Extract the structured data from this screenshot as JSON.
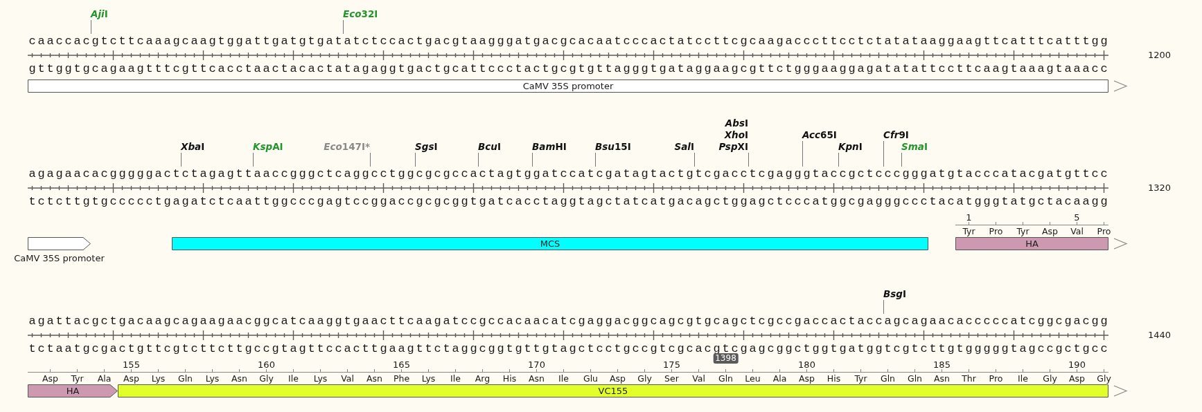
{
  "blocks": [
    {
      "top": [
        "caaccac",
        "gtcttcaaagcaagtggattgatgtgat",
        "atctccactgacgtaagggatgacgcacaatcccactatccttcgcaagacccttcctctatataaggaagttcatttcatttgg"
      ],
      "sites": [
        {
          "kind": "rightward",
          "enzymes": [
            {
              "genus": "Aji",
              "suffix": "I",
              "color": "#22962a"
            }
          ]
        },
        {
          "kind": "rightward",
          "enzymes": [
            {
              "genus": "Eco",
              "suffix": "32I",
              "color": "#22962a"
            }
          ]
        }
      ],
      "bottom": [
        "gttggtgcagaagtttcgttcacctaactacactatagaggtgactgcattccctactgcgtgttagggtgataggaagcgttctgggaaggagatatattccttcaagtaaagtaaacc"
      ],
      "features": [
        {
          "kind": "arrow",
          "name": "CaMV 35S promoter",
          "color": "#ffffff",
          "continues_right": true
        }
      ],
      "number": "1200"
    },
    {
      "top": [
        "agagaacacgggggact",
        "ctagagtt",
        "aaccgggctcagg",
        "cctgg",
        "cgcgcca",
        "ctagtg",
        "gatccat",
        "cgatagtactg",
        "tcgacc",
        "tcgagg",
        "gtac",
        "cgctc",
        "cc",
        "gggatgtacccatacgatgttcc"
      ],
      "sites": [
        {
          "kind": "rightward",
          "enzymes": [
            {
              "genus": "Xba",
              "suffix": "I",
              "color": "#111111"
            }
          ]
        },
        {
          "kind": "rightward",
          "enzymes": [
            {
              "genus": "Ksp",
              "suffix": "AI",
              "color": "#22962a"
            }
          ]
        },
        {
          "kind": "leftward",
          "enzymes": [
            {
              "genus": "Eco",
              "suffix": "147I*",
              "color": "#8a8a8a"
            }
          ]
        },
        {
          "kind": "rightward",
          "enzymes": [
            {
              "genus": "Sgs",
              "suffix": "I",
              "color": "#111111"
            }
          ]
        },
        {
          "kind": "rightward",
          "enzymes": [
            {
              "genus": "Bcu",
              "suffix": "I",
              "color": "#111111"
            }
          ]
        },
        {
          "kind": "rightward",
          "enzymes": [
            {
              "genus": "Bam",
              "suffix": "HI",
              "color": "#111111"
            }
          ]
        },
        {
          "kind": "rightward",
          "enzymes": [
            {
              "genus": "Bsu",
              "suffix": "15I",
              "color": "#111111"
            }
          ]
        },
        {
          "kind": "leftward",
          "enzymes": [
            {
              "genus": "Sal",
              "suffix": "I",
              "color": "#111111"
            }
          ]
        },
        {
          "kind": "leftward",
          "enzymes": [
            {
              "genus": "Abs",
              "suffix": "I",
              "color": "#111111"
            },
            {
              "genus": "Xho",
              "suffix": "I",
              "color": "#111111"
            },
            {
              "genus": "Psp",
              "suffix": "XI",
              "color": "#111111"
            }
          ]
        },
        {
          "kind": "rightward",
          "enzymes": [
            {
              "genus": "Acc",
              "suffix": "65I",
              "color": "#111111"
            }
          ]
        },
        {
          "kind": "rightward",
          "enzymes": [
            {
              "genus": "Kpn",
              "suffix": "I",
              "color": "#111111"
            }
          ]
        },
        {
          "kind": "rightward",
          "enzymes": [
            {
              "genus": "Cfr",
              "suffix": "9I",
              "color": "#111111"
            }
          ]
        },
        {
          "kind": "rightward",
          "enzymes": [
            {
              "genus": "Sma",
              "suffix": "I",
              "color": "#22962a"
            }
          ]
        }
      ],
      "bottom": [
        "tctcttg",
        "tgccccctg",
        "agatctcaattggcccgagtccggaccgcgcggtgatcacctaggtagctatcatgacagctggagctcccatggcgagggccc",
        "tac",
        "atgggtatgctacaagg"
      ],
      "features": [
        {
          "kind": "arrow",
          "name": "CaMV 35S promoter",
          "color": "#ffffff",
          "continues_right": false
        },
        {
          "kind": "gap"
        },
        {
          "kind": "box",
          "name": "MCS",
          "color": "#00ffff"
        },
        {
          "kind": "gap"
        },
        {
          "kind": "arrow",
          "name": "HA",
          "color": "#cc99b0",
          "continues_right": true,
          "continues_left": false,
          "residues": [
            {
              "aa": "Tyr",
              "number": "1"
            },
            {
              "aa": "Pro"
            },
            {
              "aa": "Tyr"
            },
            {
              "aa": "Asp"
            },
            {
              "aa": "Val",
              "number": "5"
            },
            {
              "aa": "Pro"
            }
          ]
        }
      ],
      "number": "1320"
    },
    {
      "top": [
        "agattacgctgacaagcagaagaacggcatcaaggtgaacttcaagatccgccacaacatcgaggacggcagcgtgcagctcgccgaccactacc",
        "agcagaacacccccatcggcgacgg"
      ],
      "sites": [
        {
          "kind": "rightward",
          "enzymes": [
            {
              "genus": "Bsg",
              "suffix": "I",
              "color": "#111111"
            }
          ]
        }
      ],
      "bottom": [
        "tctaatgcga",
        "ctgttcgtcttcttgccgtagttccacttgaagttctaggcggtgttgtagctcctgccgtcgcacgtcgagcggctggtgatggtcgtcttgtgggggtagccgctgcc"
      ],
      "cursor": {
        "label": "1398"
      },
      "features": [
        {
          "kind": "arrow",
          "name": "HA",
          "color": "#cc99b0",
          "continues_right": false,
          "continues_left": true,
          "residues": [
            {
              "aa": "Asp"
            },
            {
              "aa": "Tyr"
            },
            {
              "aa": "Ala"
            }
          ]
        },
        {
          "kind": "arrow",
          "name": "VC155",
          "color": "#e2ff2a",
          "continues_right": true,
          "continues_left": false,
          "residues": [
            {
              "aa": "Asp",
              "number": "155"
            },
            {
              "aa": "Lys"
            },
            {
              "aa": "Gln"
            },
            {
              "aa": "Lys"
            },
            {
              "aa": "Asn"
            },
            {
              "aa": "Gly",
              "number": "160"
            },
            {
              "aa": "Ile"
            },
            {
              "aa": "Lys"
            },
            {
              "aa": "Val"
            },
            {
              "aa": "Asn"
            },
            {
              "aa": "Phe",
              "number": "165"
            },
            {
              "aa": "Lys"
            },
            {
              "aa": "Ile"
            },
            {
              "aa": "Arg"
            },
            {
              "aa": "His"
            },
            {
              "aa": "Asn",
              "number": "170"
            },
            {
              "aa": "Ile"
            },
            {
              "aa": "Glu"
            },
            {
              "aa": "Asp"
            },
            {
              "aa": "Gly"
            },
            {
              "aa": "Ser",
              "number": "175"
            },
            {
              "aa": "Val"
            },
            {
              "aa": "Gln"
            },
            {
              "aa": "Leu"
            },
            {
              "aa": "Ala"
            },
            {
              "aa": "Asp",
              "number": "180"
            },
            {
              "aa": "His"
            },
            {
              "aa": "Tyr"
            },
            {
              "aa": "Gln"
            },
            {
              "aa": "Gln"
            },
            {
              "aa": "Asn",
              "number": "185"
            },
            {
              "aa": "Thr"
            },
            {
              "aa": "Pro"
            },
            {
              "aa": "Ile"
            },
            {
              "aa": "Gly"
            },
            {
              "aa": "Asp",
              "number": "190"
            },
            {
              "aa": "Gly"
            }
          ]
        }
      ],
      "number": "1440"
    }
  ]
}
